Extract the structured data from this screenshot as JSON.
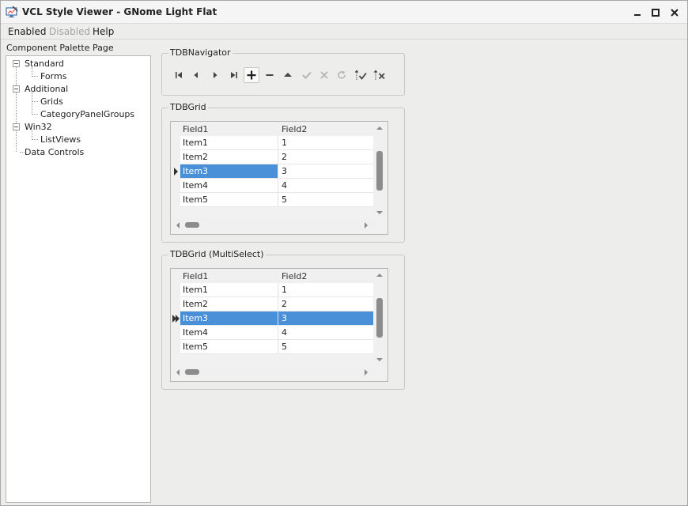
{
  "window": {
    "title": "VCL Style Viewer - GNome Light Flat",
    "controls": [
      "minimize",
      "maximize",
      "close"
    ]
  },
  "menu": {
    "items": [
      {
        "label": "Enabled",
        "enabled": true
      },
      {
        "label": "Disabled",
        "enabled": false
      },
      {
        "label": "Help",
        "enabled": true
      }
    ]
  },
  "tree": {
    "caption": "Component Palette Page",
    "nodes": [
      {
        "label": "Standard",
        "level": 0,
        "expanded": true
      },
      {
        "label": "Forms",
        "level": 1
      },
      {
        "label": "Additional",
        "level": 0,
        "expanded": true
      },
      {
        "label": "Grids",
        "level": 1
      },
      {
        "label": "CategoryPanelGroups",
        "level": 1
      },
      {
        "label": "Win32",
        "level": 0,
        "expanded": true
      },
      {
        "label": "ListViews",
        "level": 1
      },
      {
        "label": "Data Controls",
        "level": 0
      }
    ]
  },
  "navigator": {
    "caption": "TDBNavigator",
    "buttons": [
      {
        "icon": "first-record-icon",
        "enabled": true
      },
      {
        "icon": "prior-record-icon",
        "enabled": true
      },
      {
        "icon": "next-record-icon",
        "enabled": true
      },
      {
        "icon": "last-record-icon",
        "enabled": true
      },
      {
        "icon": "insert-record-icon",
        "enabled": true,
        "active": true
      },
      {
        "icon": "delete-record-icon",
        "enabled": true
      },
      {
        "icon": "edit-record-icon",
        "enabled": true
      },
      {
        "icon": "post-edit-icon",
        "enabled": false
      },
      {
        "icon": "cancel-edit-icon",
        "enabled": false
      },
      {
        "icon": "refresh-data-icon",
        "enabled": false
      },
      {
        "icon": "apply-updates-icon",
        "enabled": true
      },
      {
        "icon": "cancel-updates-icon",
        "enabled": true
      }
    ]
  },
  "grid": {
    "caption": "TDBGrid",
    "columns": [
      "Field1",
      "Field2"
    ],
    "rows": [
      [
        "Item1",
        "1"
      ],
      [
        "Item2",
        "2"
      ],
      [
        "Item3",
        "3"
      ],
      [
        "Item4",
        "4"
      ],
      [
        "Item5",
        "5"
      ]
    ],
    "selected_row": 2
  },
  "grid_multi": {
    "caption": "TDBGrid (MultiSelect)",
    "columns": [
      "Field1",
      "Field2"
    ],
    "rows": [
      [
        "Item1",
        "1"
      ],
      [
        "Item2",
        "2"
      ],
      [
        "Item3",
        "3"
      ],
      [
        "Item4",
        "4"
      ],
      [
        "Item5",
        "5"
      ]
    ],
    "selected_row": 2
  },
  "colors": {
    "selection": "#4a90d9",
    "window_bg": "#ededeb",
    "disabled_text": "#a3a3a3"
  }
}
